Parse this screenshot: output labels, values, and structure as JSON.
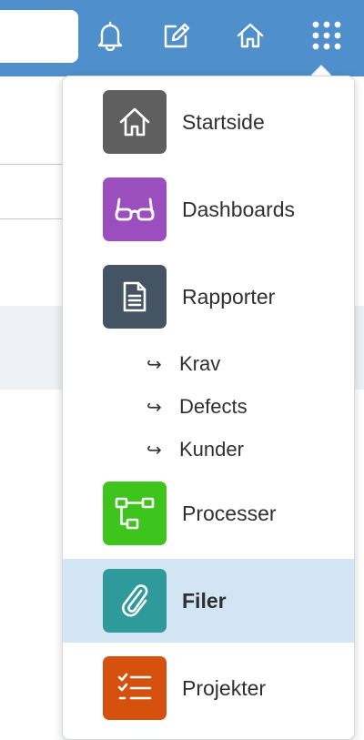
{
  "topbar": {
    "background": "#4f8fcc",
    "icons": [
      "bell-icon",
      "edit-icon",
      "home-icon",
      "apps-grid-icon"
    ]
  },
  "menu": {
    "items": [
      {
        "label": "Startside",
        "icon": "home-icon",
        "color": "#5f5f5f"
      },
      {
        "label": "Dashboards",
        "icon": "glasses-icon",
        "color": "#9b4fbf"
      },
      {
        "label": "Rapporter",
        "icon": "document-icon",
        "color": "#455463"
      },
      {
        "label": "Processer",
        "icon": "flowchart-icon",
        "color": "#3ec41c"
      },
      {
        "label": "Filer",
        "icon": "paperclip-icon",
        "color": "#2f9a9a",
        "active": true
      },
      {
        "label": "Projekter",
        "icon": "checklist-icon",
        "color": "#d5510d"
      }
    ],
    "sub_items": [
      {
        "arrow": "↪",
        "label": "Krav"
      },
      {
        "arrow": "↪",
        "label": "Defects"
      },
      {
        "arrow": "↪",
        "label": "Kunder"
      }
    ]
  }
}
